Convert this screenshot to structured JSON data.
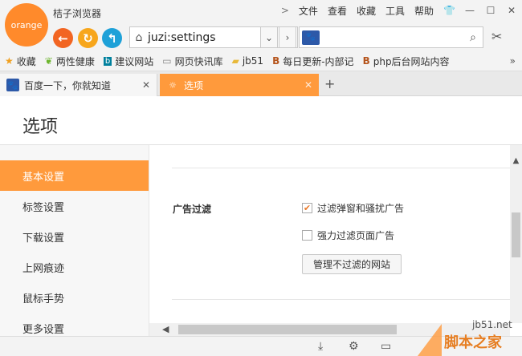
{
  "app": {
    "logo_text": "orange",
    "title": "桔子浏览器"
  },
  "menu": {
    "items": [
      "文件",
      "查看",
      "收藏",
      "工具",
      "帮助"
    ],
    "more_glyph": ">"
  },
  "toolbar": {
    "address": "juzi:settings",
    "search_value": "",
    "search_engine_glyph": "🐾"
  },
  "bookmarks": [
    {
      "label": "收藏",
      "icon": "star-icon"
    },
    {
      "label": "两性健康",
      "icon": "leaf-icon"
    },
    {
      "label": "建议网站",
      "icon": "bing-icon"
    },
    {
      "label": "网页快讯库",
      "icon": "page-icon"
    },
    {
      "label": "jb51",
      "icon": "folder-icon"
    },
    {
      "label": "每日更新-内部记",
      "icon": "b-icon"
    },
    {
      "label": "php后台网站内容",
      "icon": "b-icon"
    }
  ],
  "tabs": [
    {
      "label": "百度一下，你就知道",
      "active": false
    },
    {
      "label": "选项",
      "active": true
    }
  ],
  "page": {
    "title": "选项"
  },
  "sidebar": {
    "items": [
      "基本设置",
      "标签设置",
      "下载设置",
      "上网痕迹",
      "鼠标手势",
      "更多设置"
    ],
    "active_index": 0
  },
  "settings": {
    "section_label": "广告过滤",
    "options": [
      {
        "label": "过滤弹窗和骚扰广告",
        "checked": true
      },
      {
        "label": "强力过滤页面广告",
        "checked": false
      }
    ],
    "manage_button": "管理不过滤的网站"
  },
  "watermark": {
    "small": "jb51.net",
    "big": "脚本之家"
  },
  "colors": {
    "accent": "#ff9a3c",
    "back_button": "#f26522",
    "refresh_button": "#f7a61c",
    "home_button": "#1ea1d8"
  }
}
